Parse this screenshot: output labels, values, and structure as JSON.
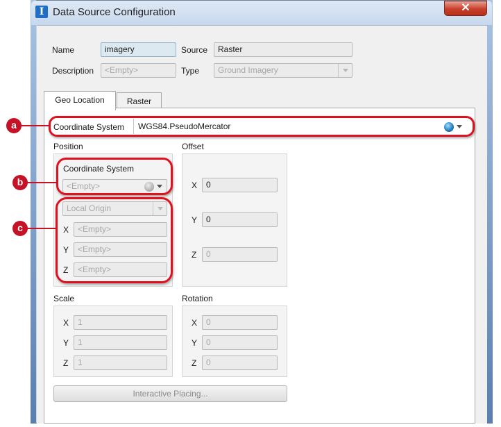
{
  "window": {
    "title": "Data Source Configuration",
    "close_glyph": "✕",
    "app_icon_glyph": "I"
  },
  "header": {
    "name_label": "Name",
    "name_value": "imagery",
    "source_label": "Source",
    "source_value": "Raster",
    "description_label": "Description",
    "description_placeholder": "<Empty>",
    "type_label": "Type",
    "type_value": "Ground Imagery"
  },
  "tabs": [
    {
      "label": "Geo Location",
      "active": true
    },
    {
      "label": "Raster",
      "active": false
    }
  ],
  "geo": {
    "coord_system_label": "Coordinate System",
    "coord_system_value": "WGS84.PseudoMercator",
    "position": {
      "label": "Position",
      "coord_system_label": "Coordinate System",
      "coord_system_placeholder": "<Empty>",
      "local_origin": "Local Origin",
      "x_label": "X",
      "x_value": "<Empty>",
      "y_label": "Y",
      "y_value": "<Empty>",
      "z_label": "Z",
      "z_value": "<Empty>"
    },
    "offset": {
      "label": "Offset",
      "x_label": "X",
      "x_value": "0",
      "y_label": "Y",
      "y_value": "0",
      "z_label": "Z",
      "z_value": "0"
    },
    "scale": {
      "label": "Scale",
      "x_label": "X",
      "x_value": "1",
      "y_label": "Y",
      "y_value": "1",
      "z_label": "Z",
      "z_value": "1"
    },
    "rotation": {
      "label": "Rotation",
      "x_label": "X",
      "x_value": "0",
      "y_label": "Y",
      "y_value": "0",
      "z_label": "Z",
      "z_value": "0"
    },
    "interactive_placing": "Interactive Placing..."
  },
  "callouts": {
    "a": "a",
    "b": "b",
    "c": "c"
  },
  "colors": {
    "callout": "#c51227",
    "highlight": "#e0101e"
  }
}
